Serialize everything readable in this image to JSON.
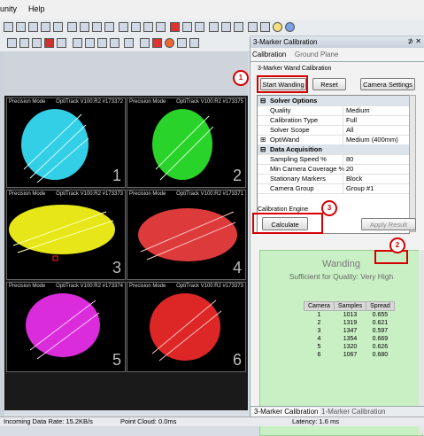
{
  "menu": {
    "items": [
      "unity",
      "Help"
    ]
  },
  "viewports": [
    {
      "label": "Precision Mode",
      "camera": "OptiTrack V100:R2 #173372",
      "number": "1",
      "color": "#39e6ff"
    },
    {
      "label": "Precision Mode",
      "camera": "OptiTrack V100:R2 #173375",
      "number": "2",
      "color": "#2eea2e"
    },
    {
      "label": "Precision Mode",
      "camera": "OptiTrack V100:R2 #173373",
      "number": "3",
      "color": "#f2f21a"
    },
    {
      "label": "Precision Mode",
      "camera": "OptiTrack V100:R2 #173371",
      "number": "4",
      "color": "#f04040"
    },
    {
      "label": "Precision Mode",
      "camera": "OptiTrack V100:R2 #173374",
      "number": "5",
      "color": "#ee30ee"
    },
    {
      "label": "Precision Mode",
      "camera": "OptiTrack V100:R2 #173373",
      "number": "6",
      "color": "#f02a2a"
    }
  ],
  "panel": {
    "title": "3-Marker Calibration",
    "tabs": [
      "Calibration",
      "Ground Plane"
    ],
    "section_label": "3-Marker Wand Calibration",
    "buttons": {
      "start": "Start Wanding",
      "reset": "Reset",
      "camera_settings": "Camera Settings"
    },
    "solver_options_header": "Solver Options",
    "solver_options": [
      {
        "key": "Quality",
        "value": "Medium"
      },
      {
        "key": "Calibration Type",
        "value": "Full"
      },
      {
        "key": "Solver Scope",
        "value": "All"
      },
      {
        "key": "OptiWand",
        "value": "Medium (400mm)"
      }
    ],
    "data_acq_header": "Data Acquisition",
    "data_acquisition": [
      {
        "key": "Sampling Speed %",
        "value": "80"
      },
      {
        "key": "Min Camera Coverage %",
        "value": "20"
      },
      {
        "key": "Stationary Markers",
        "value": "Block"
      },
      {
        "key": "Camera Group",
        "value": "Group #1"
      }
    ],
    "engine_label": "Calibration Engine",
    "calculate": "Calculate",
    "apply_result": "Apply Result",
    "wanding": {
      "title": "Wanding",
      "quality_prefix": "Sufficient for Quality:",
      "quality_value": "Very High",
      "columns": [
        "Camera",
        "Samples",
        "Spread"
      ],
      "rows": [
        [
          "1",
          "1013",
          "0.655"
        ],
        [
          "2",
          "1319",
          "0.621"
        ],
        [
          "3",
          "1347",
          "0.597"
        ],
        [
          "4",
          "1354",
          "0.669"
        ],
        [
          "5",
          "1320",
          "0.626"
        ],
        [
          "6",
          "1067",
          "0.680"
        ]
      ]
    },
    "bottom_tabs": [
      "3-Marker Calibration",
      "1-Marker Calibration"
    ]
  },
  "annotations": [
    "1",
    "2",
    "3"
  ],
  "status": {
    "incoming": "Incoming Data Rate: 15.2KB/s",
    "cloud": "Point Cloud: 0.0ms",
    "latency": "Latency: 1.6 ms"
  }
}
